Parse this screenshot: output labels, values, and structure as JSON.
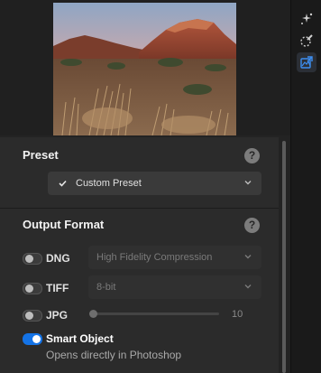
{
  "toolbar": {
    "tools": [
      {
        "icon": "magic-wand-sparkle-icon",
        "active": false
      },
      {
        "icon": "brush-selection-icon",
        "active": false
      },
      {
        "icon": "export-image-icon",
        "active": true
      }
    ]
  },
  "preview": {
    "alt": "Desert landscape with red mesa at dusk"
  },
  "preset": {
    "title": "Preset",
    "help": "?",
    "selected": "Custom Preset"
  },
  "output_format": {
    "title": "Output Format",
    "help": "?",
    "options": [
      {
        "label": "DNG",
        "enabled": false,
        "setting": "High Fidelity Compression"
      },
      {
        "label": "TIFF",
        "enabled": false,
        "setting": "8-bit"
      },
      {
        "label": "JPG",
        "enabled": false,
        "quality": "10"
      }
    ],
    "smart_object": {
      "label": "Smart Object",
      "enabled": true,
      "description": "Opens directly in Photoshop"
    }
  },
  "colors": {
    "accent": "#1473e6",
    "panel": "#2b2b2b"
  }
}
